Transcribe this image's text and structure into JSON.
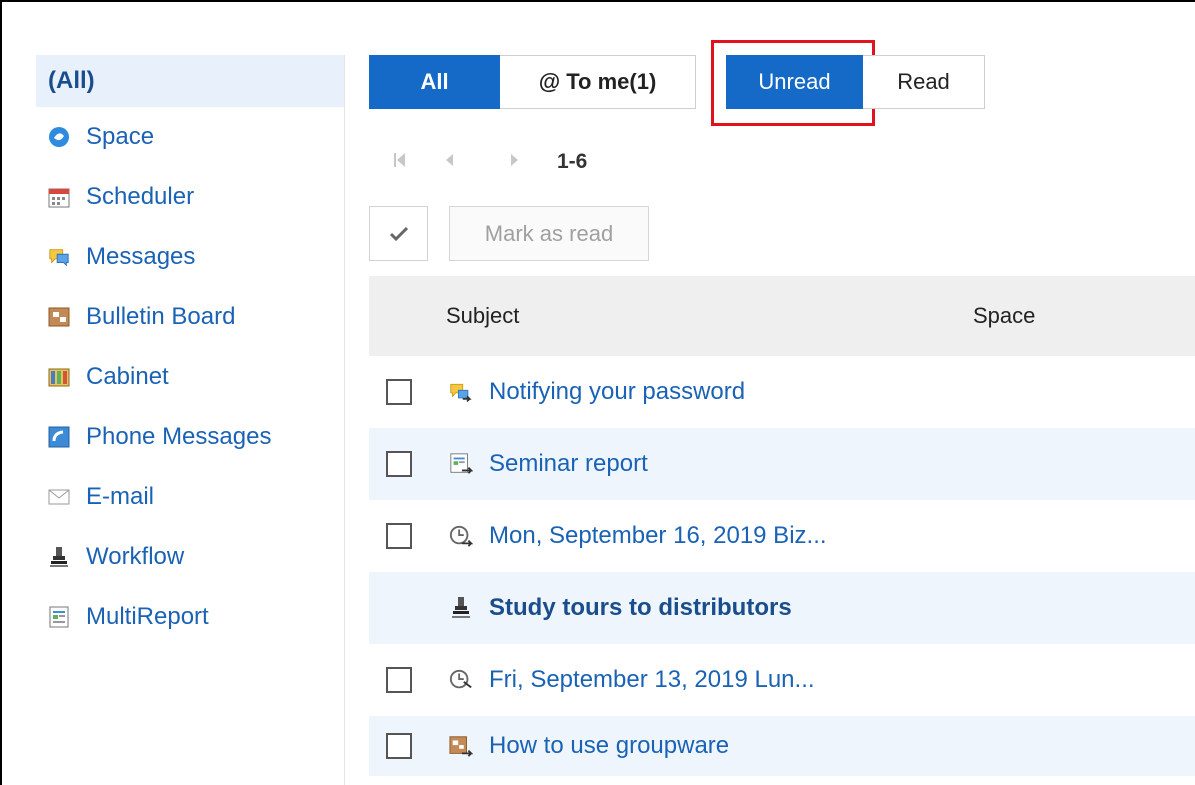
{
  "sidebar": {
    "items": [
      {
        "label": "(All)",
        "icon": "none"
      },
      {
        "label": "Space",
        "icon": "space-icon"
      },
      {
        "label": "Scheduler",
        "icon": "calendar-icon"
      },
      {
        "label": "Messages",
        "icon": "speech-bubble-icon"
      },
      {
        "label": "Bulletin Board",
        "icon": "bulletin-board-icon"
      },
      {
        "label": "Cabinet",
        "icon": "cabinet-icon"
      },
      {
        "label": "Phone Messages",
        "icon": "phone-icon"
      },
      {
        "label": "E-mail",
        "icon": "envelope-icon"
      },
      {
        "label": "Workflow",
        "icon": "stamp-icon"
      },
      {
        "label": "MultiReport",
        "icon": "report-icon"
      }
    ]
  },
  "filters": {
    "all": "All",
    "to_me": "@ To me(1)",
    "unread": "Unread",
    "read": "Read"
  },
  "pager": {
    "range": "1-6"
  },
  "toolbar": {
    "mark_as_read": "Mark as read"
  },
  "table": {
    "columns": {
      "subject": "Subject",
      "space": "Space"
    },
    "rows": [
      {
        "subject": "Notifying your password",
        "icon": "message-icon",
        "checkbox": true,
        "bold": false
      },
      {
        "subject": "Seminar report",
        "icon": "report-icon",
        "checkbox": true,
        "bold": false
      },
      {
        "subject": "Mon, September 16, 2019 Biz...",
        "icon": "clock-icon",
        "checkbox": true,
        "bold": false
      },
      {
        "subject": "Study tours to distributors",
        "icon": "stamp-icon",
        "checkbox": false,
        "bold": true
      },
      {
        "subject": "Fri, September 13, 2019 Lun...",
        "icon": "clock-icon",
        "checkbox": true,
        "bold": false
      },
      {
        "subject": "How to use groupware",
        "icon": "bulletin-board-icon",
        "checkbox": true,
        "bold": false
      }
    ]
  },
  "colors": {
    "accent": "#1569c7",
    "link": "#1a62b5",
    "highlight_frame": "#e0121c",
    "row_alt": "#eef5fc"
  }
}
